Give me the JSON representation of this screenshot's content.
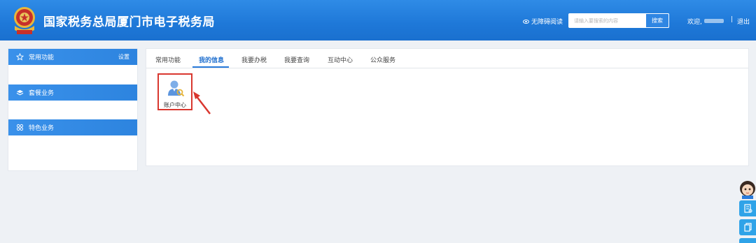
{
  "header": {
    "title": "国家税务总局厦门市电子税务局",
    "accessibility_label": "无障碍阅读",
    "search_placeholder": "请输入要搜索的内容",
    "search_button": "搜索",
    "welcome": "欢迎,",
    "separator": "|",
    "logout": "退出",
    "emblem_text": "国家税务"
  },
  "sidebar": {
    "sections": [
      {
        "label": "常用功能",
        "icon": "star-icon",
        "action": "设置"
      },
      {
        "label": "套餐业务",
        "icon": "layers-icon"
      },
      {
        "label": "特色业务",
        "icon": "grid-icon"
      }
    ]
  },
  "main": {
    "tabs": [
      {
        "label": "常用功能",
        "active": false
      },
      {
        "label": "我的信息",
        "active": true
      },
      {
        "label": "我要办税",
        "active": false
      },
      {
        "label": "我要查询",
        "active": false
      },
      {
        "label": "互动中心",
        "active": false
      },
      {
        "label": "公众服务",
        "active": false
      }
    ],
    "apps": [
      {
        "label": "账户中心",
        "icon": "account-user-icon",
        "highlighted": true
      }
    ]
  },
  "float": {
    "items": [
      "avatar-assistant-icon",
      "document-icon",
      "copy-icon"
    ]
  },
  "colors": {
    "header_blue": "#1e78d8",
    "accent_blue": "#2a7bdb",
    "highlight_red": "#d9372f",
    "float_blue": "#2fa3e8"
  }
}
